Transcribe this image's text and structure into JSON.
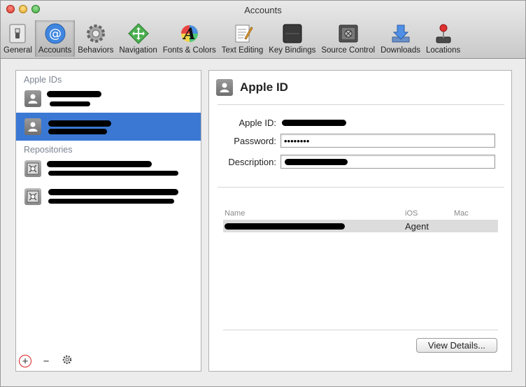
{
  "window": {
    "title": "Accounts"
  },
  "toolbar": {
    "items": [
      {
        "label": "General",
        "icon": "switch-icon"
      },
      {
        "label": "Accounts",
        "icon": "at-sign-icon",
        "active": true
      },
      {
        "label": "Behaviors",
        "icon": "gear-icon"
      },
      {
        "label": "Navigation",
        "icon": "move-arrows-icon"
      },
      {
        "label": "Fonts & Colors",
        "icon": "font-a-icon"
      },
      {
        "label": "Text Editing",
        "icon": "notepad-pencil-icon"
      },
      {
        "label": "Key Bindings",
        "icon": "keyboard-key-icon"
      },
      {
        "label": "Source Control",
        "icon": "safe-icon"
      },
      {
        "label": "Downloads",
        "icon": "download-tray-icon"
      },
      {
        "label": "Locations",
        "icon": "joystick-icon"
      }
    ]
  },
  "sidebar": {
    "apple_ids_header": "Apple IDs",
    "repositories_header": "Repositories"
  },
  "detail": {
    "title": "Apple ID",
    "apple_id_label": "Apple ID:",
    "password_label": "Password:",
    "password_value": "••••••••",
    "description_label": "Description:",
    "table": {
      "headers": {
        "name": "Name",
        "ios": "iOS",
        "mac": "Mac"
      },
      "rows": [
        {
          "ios": "Agent",
          "mac": ""
        }
      ]
    },
    "view_details_label": "View Details..."
  },
  "footer": {
    "add": "+",
    "remove": "−"
  },
  "colors": {
    "selection": "#3a78d4",
    "redaction": "#000000"
  }
}
